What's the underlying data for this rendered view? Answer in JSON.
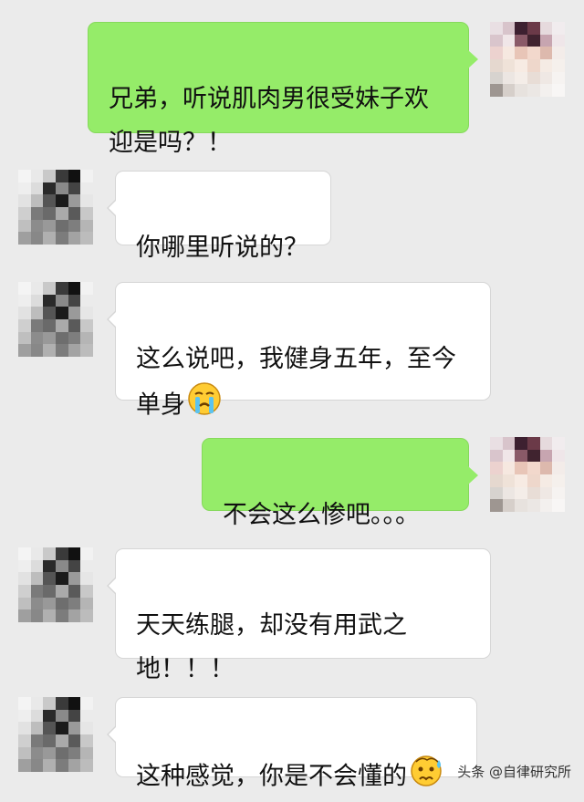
{
  "colors": {
    "background": "#ebebeb",
    "bubble_sent": "#95ec69",
    "bubble_received": "#ffffff"
  },
  "messages": [
    {
      "side": "right",
      "text": "兄弟，听说肌肉男很受妹子欢\n迎是吗？！",
      "emoji": ""
    },
    {
      "side": "left",
      "text": "你哪里听说的？",
      "emoji": ""
    },
    {
      "side": "left",
      "text": "这么说吧，我健身五年，至今\n单身",
      "emoji": "crying-face"
    },
    {
      "side": "right",
      "text": "不会这么惨吧。。。",
      "emoji": ""
    },
    {
      "side": "left",
      "text": "天天练腿，却没有用武之\n地！！！",
      "emoji": ""
    },
    {
      "side": "left",
      "text": "这种感觉，你是不会懂的",
      "emoji": "anxious-sweat-face"
    }
  ],
  "watermark": "头条 @自律研究所"
}
